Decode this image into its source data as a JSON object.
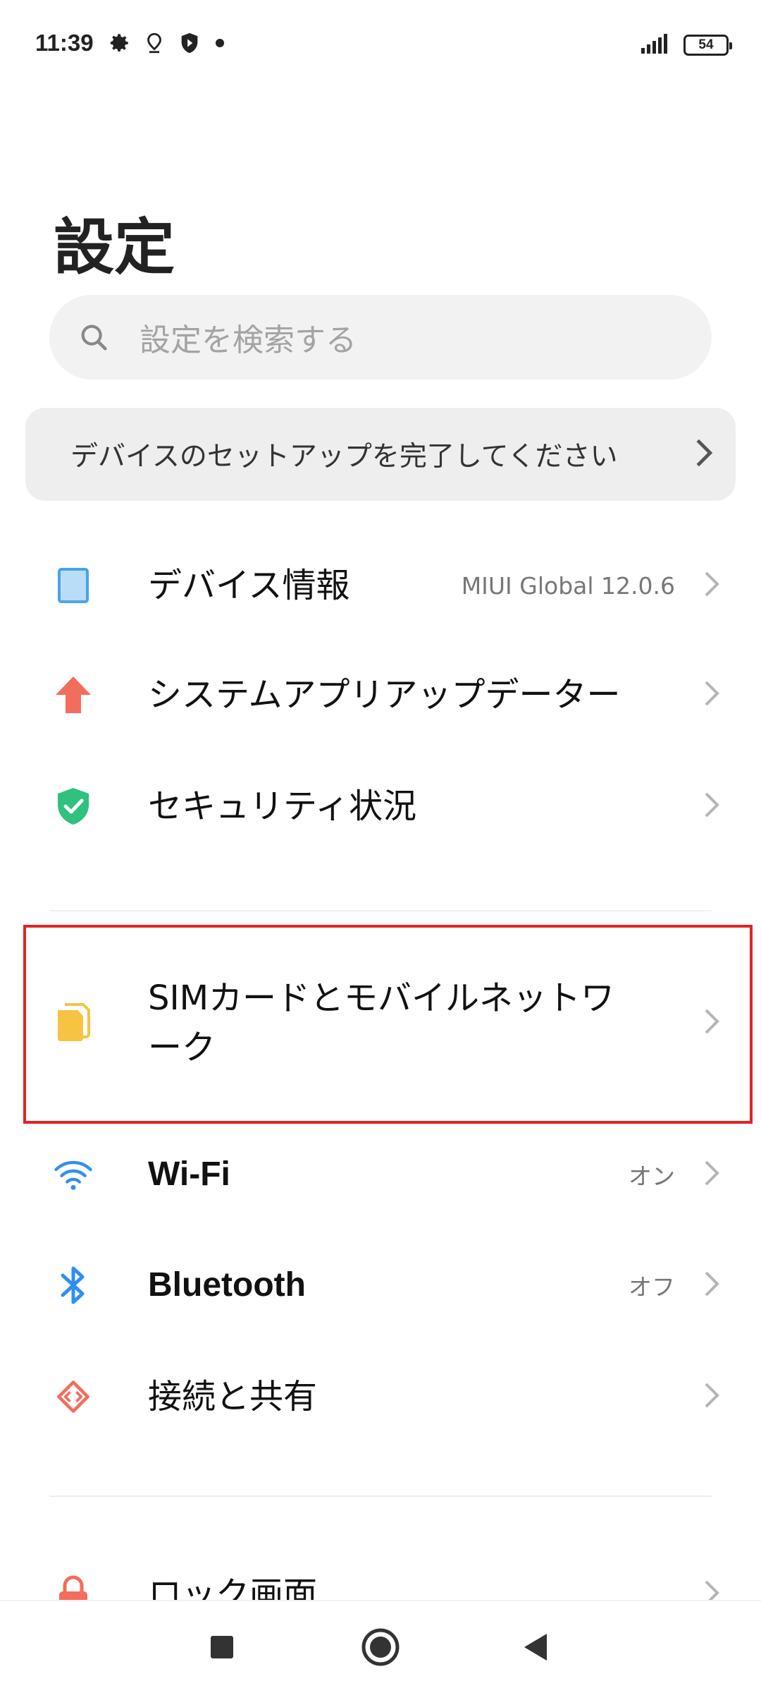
{
  "status_bar": {
    "time": "11:39",
    "battery": "54",
    "icons_left": [
      "gear-icon",
      "location-pin-icon",
      "shield-play-icon",
      "dot-icon"
    ],
    "icons_right": [
      "signal-icon",
      "battery-icon"
    ]
  },
  "page": {
    "title": "設定"
  },
  "search": {
    "placeholder": "設定を検索する"
  },
  "banner": {
    "text": "デバイスのセットアップを完了してください"
  },
  "items": [
    {
      "label": "デバイス情報",
      "value": "MIUI Global 12.0.6",
      "icon": "device-icon",
      "color": "#4aa3e8"
    },
    {
      "label": "システムアプリアップデーター",
      "value": "",
      "icon": "arrow-up-icon",
      "color": "#f26d5b"
    },
    {
      "label": "セキュリティ状況",
      "value": "",
      "icon": "shield-check-icon",
      "color": "#2ec27e"
    },
    {
      "label": "SIMカードとモバイルネットワーク",
      "value": "",
      "icon": "sim-card-icon",
      "color": "#f6c343"
    },
    {
      "label": "Wi-Fi",
      "value": "オン",
      "icon": "wifi-icon",
      "color": "#2f8ff0"
    },
    {
      "label": "Bluetooth",
      "value": "オフ",
      "icon": "bluetooth-icon",
      "color": "#2f8ff0"
    },
    {
      "label": "接続と共有",
      "value": "",
      "icon": "share-icon",
      "color": "#f26d5b"
    },
    {
      "label": "ロック画面",
      "value": "",
      "icon": "lock-icon",
      "color": "#f26d5b"
    }
  ],
  "nav": {
    "buttons": [
      "recents-icon",
      "home-icon",
      "back-icon"
    ]
  }
}
